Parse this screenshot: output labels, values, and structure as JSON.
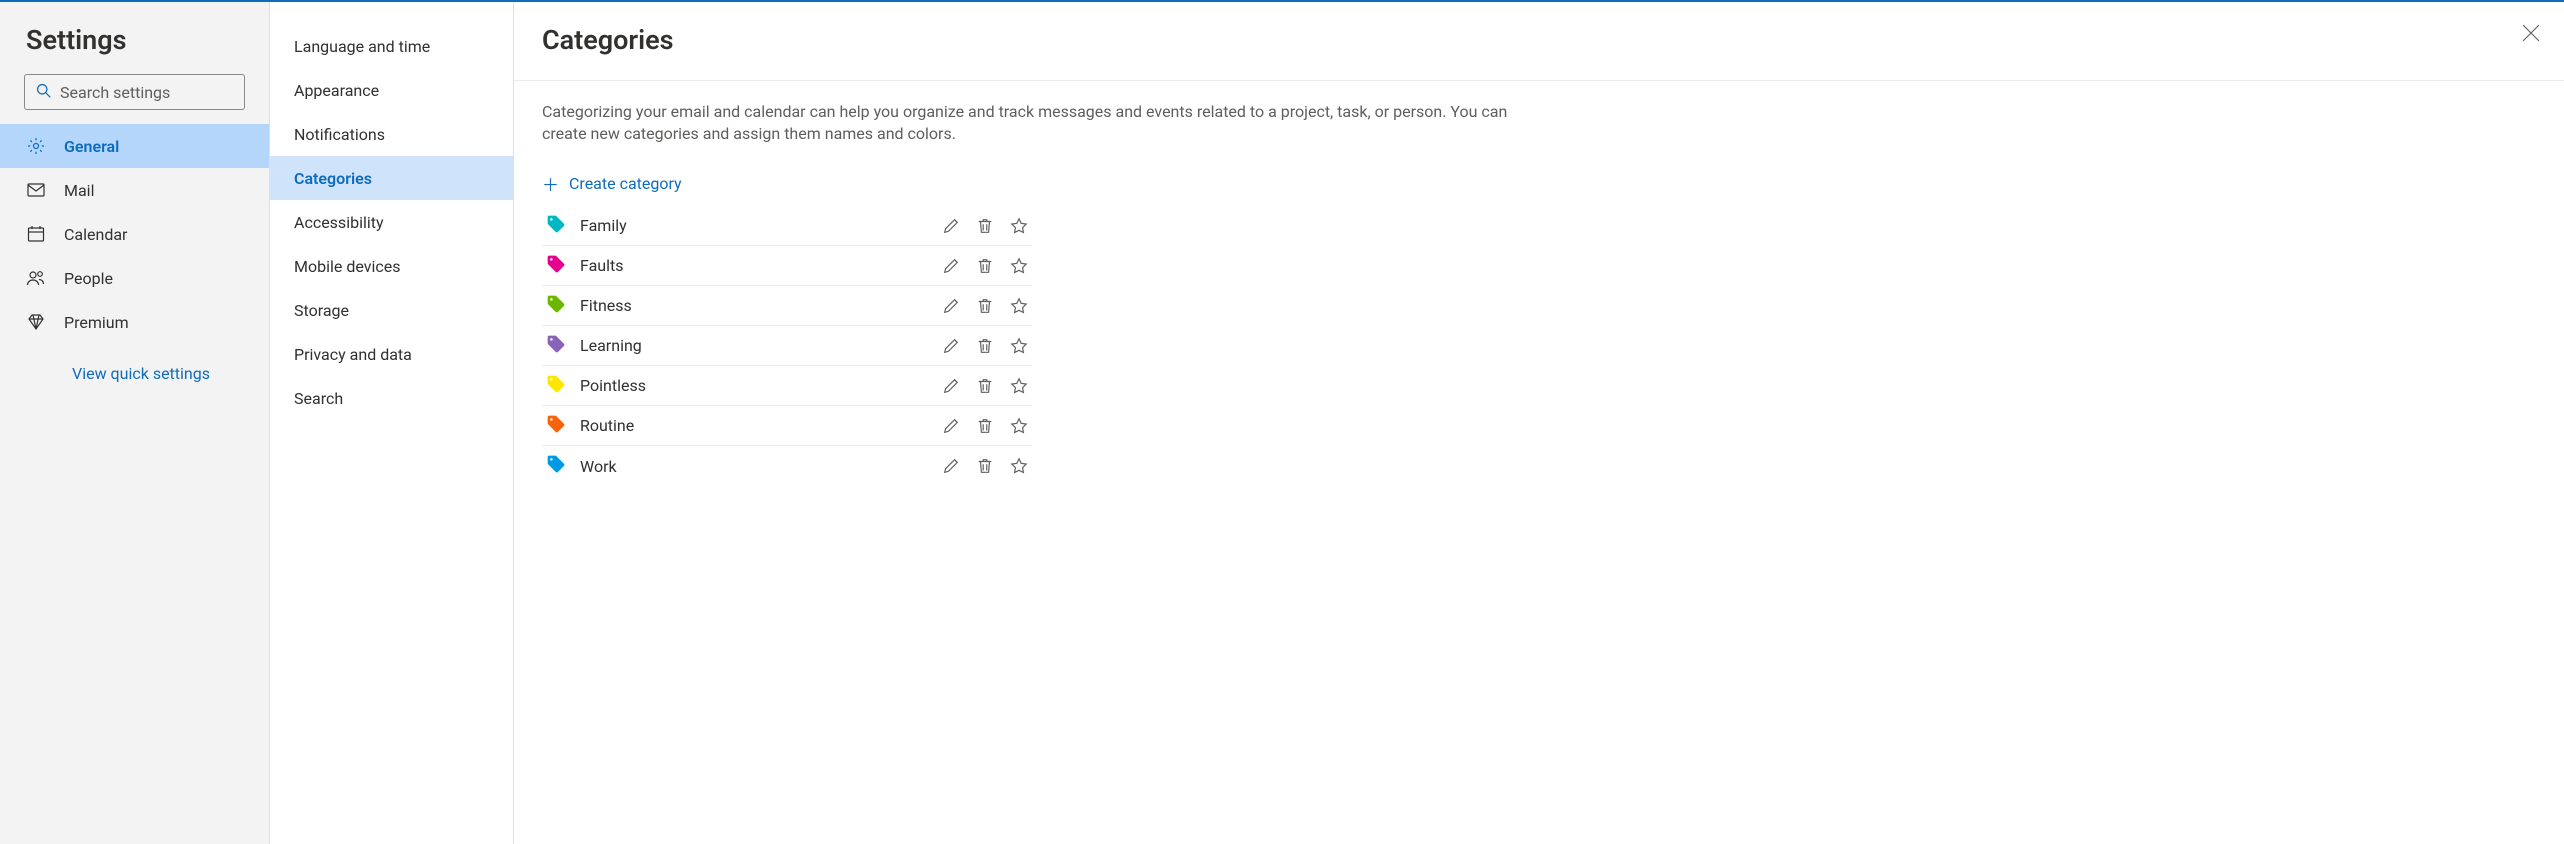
{
  "sidebar": {
    "title": "Settings",
    "search_placeholder": "Search settings",
    "items": [
      {
        "label": "General",
        "icon": "gear",
        "active": true
      },
      {
        "label": "Mail",
        "icon": "mail",
        "active": false
      },
      {
        "label": "Calendar",
        "icon": "calendar",
        "active": false
      },
      {
        "label": "People",
        "icon": "people",
        "active": false
      },
      {
        "label": "Premium",
        "icon": "diamond",
        "active": false
      }
    ],
    "quick_link": "View quick settings"
  },
  "subnav": {
    "items": [
      {
        "label": "Language and time",
        "active": false
      },
      {
        "label": "Appearance",
        "active": false
      },
      {
        "label": "Notifications",
        "active": false
      },
      {
        "label": "Categories",
        "active": true
      },
      {
        "label": "Accessibility",
        "active": false
      },
      {
        "label": "Mobile devices",
        "active": false
      },
      {
        "label": "Storage",
        "active": false
      },
      {
        "label": "Privacy and data",
        "active": false
      },
      {
        "label": "Search",
        "active": false
      }
    ]
  },
  "main": {
    "title": "Categories",
    "description": "Categorizing your email and calendar can help you organize and track messages and events related to a project, task, or person. You can create new categories and assign them names and colors.",
    "create_label": "Create category",
    "categories": [
      {
        "name": "Family",
        "color": "#00b7c3"
      },
      {
        "name": "Faults",
        "color": "#e3008c"
      },
      {
        "name": "Fitness",
        "color": "#6bb700"
      },
      {
        "name": "Learning",
        "color": "#8764b8"
      },
      {
        "name": "Pointless",
        "color": "#ffe600"
      },
      {
        "name": "Routine",
        "color": "#f7630c"
      },
      {
        "name": "Work",
        "color": "#0099e6"
      }
    ]
  }
}
